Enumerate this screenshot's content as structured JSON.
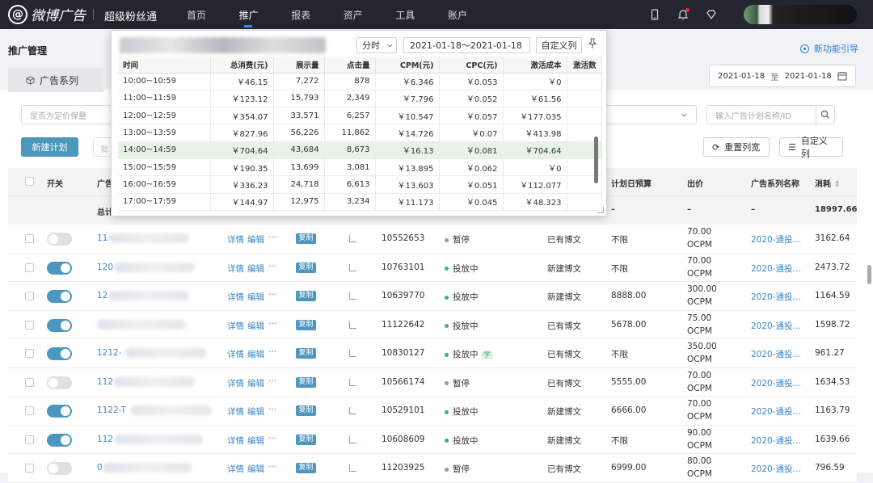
{
  "brand": {
    "logo_text": "微博广告",
    "product": "超级粉丝通"
  },
  "nav": [
    "首页",
    "推广",
    "报表",
    "资产",
    "工具",
    "账户"
  ],
  "page_title": "推广管理",
  "series_tab": "广告系列",
  "new_feature_link": "新功能引导",
  "date_range": {
    "start": "2021-01-18",
    "sep": "至",
    "end": "2021-01-18"
  },
  "filters": {
    "ocpm_placeholder": "是否为定价保量",
    "search_placeholder": "输入广告计划名称/ID"
  },
  "toolbar": {
    "new_plan": "新建计划",
    "batch": "批",
    "reset_cols": "重置列宽",
    "custom_cols": "自定义列"
  },
  "table": {
    "headers": {
      "switch": "开关",
      "name": "广告",
      "budget": "计划日预算",
      "bid": "出价",
      "series": "广告系列名称",
      "spend": "消耗"
    },
    "summary": {
      "label": "总计",
      "budget": "–",
      "bid": "–",
      "series": "–",
      "spend": "18997.66"
    },
    "actions": {
      "detail": "详情",
      "edit": "编辑",
      "more": "···",
      "copy": "复制"
    },
    "rows": [
      {
        "on": false,
        "name": "11",
        "id": "10552653",
        "status": "暂停",
        "status_color": "#999999",
        "content": "已有博文",
        "budget": "不限",
        "bid": "70.00",
        "bid_type": "OCPM",
        "series": "2020-通投…",
        "spend": "3162.64",
        "tag": ""
      },
      {
        "on": true,
        "name": "120",
        "id": "10763101",
        "status": "投放中",
        "status_color": "#36b37e",
        "content": "新建博文",
        "budget": "不限",
        "bid": "70.00",
        "bid_type": "OCPM",
        "series": "2020-通投…",
        "spend": "2473.72",
        "tag": ""
      },
      {
        "on": true,
        "name": "12",
        "id": "10639770",
        "status": "投放中",
        "status_color": "#36b37e",
        "content": "新建博文",
        "budget": "8888.00",
        "bid": "300.00",
        "bid_type": "OCPM",
        "series": "2020-通投…",
        "spend": "1164.59",
        "tag": ""
      },
      {
        "on": true,
        "name": "",
        "id": "11122642",
        "status": "投放中",
        "status_color": "#36b37e",
        "content": "已有博文",
        "budget": "5678.00",
        "bid": "75.00",
        "bid_type": "OCPM",
        "series": "2020-通投…",
        "spend": "1598.72",
        "tag": ""
      },
      {
        "on": true,
        "name": "1212-",
        "id": "10830127",
        "status": "投放中",
        "status_color": "#36b37e",
        "content": "已有博文",
        "budget": "不限",
        "bid": "350.00",
        "bid_type": "OCPM",
        "series": "2020-通投…",
        "spend": "961.27",
        "tag": "学"
      },
      {
        "on": false,
        "name": "112",
        "id": "10566174",
        "status": "暂停",
        "status_color": "#999999",
        "content": "已有博文",
        "budget": "5555.00",
        "bid": "70.00",
        "bid_type": "OCPM",
        "series": "2020-通投…",
        "spend": "1634.53",
        "tag": ""
      },
      {
        "on": true,
        "name": "1122-T",
        "id": "10529101",
        "status": "投放中",
        "status_color": "#36b37e",
        "content": "新建博文",
        "budget": "6666.00",
        "bid": "70.00",
        "bid_type": "OCPM",
        "series": "2020-通投…",
        "spend": "1163.79",
        "tag": ""
      },
      {
        "on": true,
        "name": "112",
        "id": "10608609",
        "status": "投放中",
        "status_color": "#36b37e",
        "content": "新建博文",
        "budget": "不限",
        "bid": "90.00",
        "bid_type": "OCPM",
        "series": "2020-通投…",
        "spend": "1639.66",
        "tag": ""
      },
      {
        "on": false,
        "name": "0",
        "id": "11203925",
        "status": "暂停",
        "status_color": "#999999",
        "content": "已有博文",
        "budget": "6999.00",
        "bid": "80.00",
        "bid_type": "OCPM",
        "series": "2020-通投…",
        "spend": "796.59",
        "tag": ""
      }
    ]
  },
  "popup": {
    "granularity": "分时",
    "date_range": "2021-01-18～2021-01-18",
    "custom": "自定义列",
    "columns": [
      "时间",
      "总消费(元)",
      "展示量",
      "点击量",
      "CPM(元)",
      "CPC(元)",
      "激活成本",
      "激活数"
    ],
    "rows": [
      [
        "10:00~10:59",
        "￥46.15",
        "7,272",
        "878",
        "￥6.346",
        "￥0.053",
        "￥0",
        ""
      ],
      [
        "11:00~11:59",
        "￥123.12",
        "15,793",
        "2,349",
        "￥7.796",
        "￥0.052",
        "￥61.56",
        ""
      ],
      [
        "12:00~12:59",
        "￥354.07",
        "33,571",
        "6,257",
        "￥10.547",
        "￥0.057",
        "￥177.035",
        ""
      ],
      [
        "13:00~13:59",
        "￥827.96",
        "56,226",
        "11,862",
        "￥14.726",
        "￥0.07",
        "￥413.98",
        ""
      ],
      [
        "14:00~14:59",
        "￥704.64",
        "43,684",
        "8,673",
        "￥16.13",
        "￥0.081",
        "￥704.64",
        ""
      ],
      [
        "15:00~15:59",
        "￥190.35",
        "13,699",
        "3,081",
        "￥13.895",
        "￥0.062",
        "￥0",
        ""
      ],
      [
        "16:00~16:59",
        "￥336.23",
        "24,718",
        "6,613",
        "￥13.603",
        "￥0.051",
        "￥112.077",
        ""
      ],
      [
        "17:00~17:59",
        "￥144.97",
        "12,975",
        "3,234",
        "￥11.173",
        "￥0.045",
        "￥48.323",
        ""
      ]
    ],
    "highlight_row": 4
  }
}
